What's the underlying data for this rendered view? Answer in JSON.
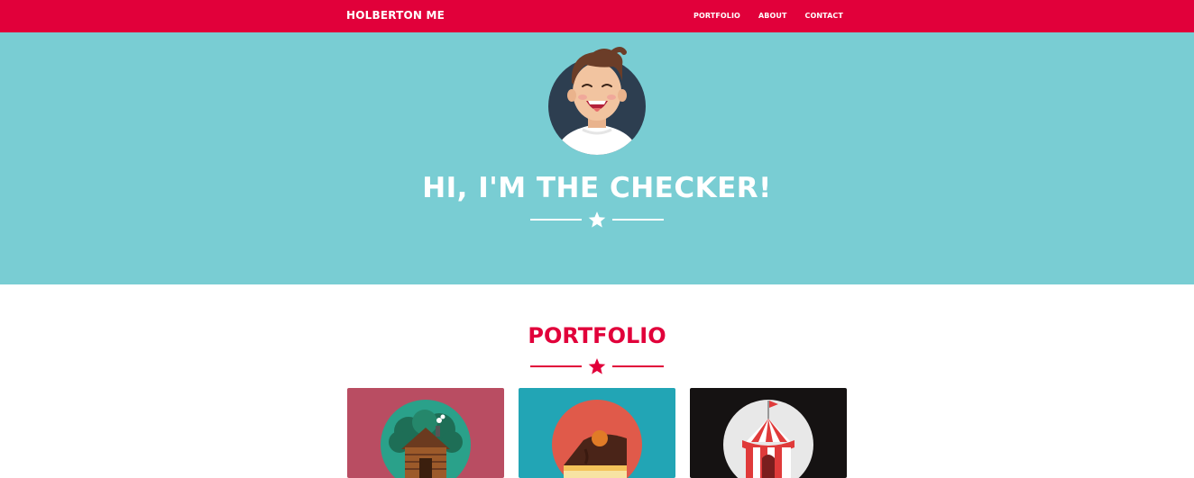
{
  "navbar": {
    "brand": "HOLBERTON ME",
    "links": [
      "PORTFOLIO",
      "ABOUT",
      "CONTACT"
    ]
  },
  "hero": {
    "title": "HI, I'M THE CHECKER!"
  },
  "portfolio": {
    "title": "PORTFOLIO",
    "items": [
      {
        "icon": "log-cabin-icon",
        "color": "#b94d62"
      },
      {
        "icon": "cake-slice-icon",
        "color": "#22a5b5"
      },
      {
        "icon": "circus-tent-icon",
        "color": "#151212"
      }
    ]
  },
  "colors": {
    "primary": "#e1003a",
    "hero_bg": "#79cdd3",
    "white": "#ffffff"
  }
}
